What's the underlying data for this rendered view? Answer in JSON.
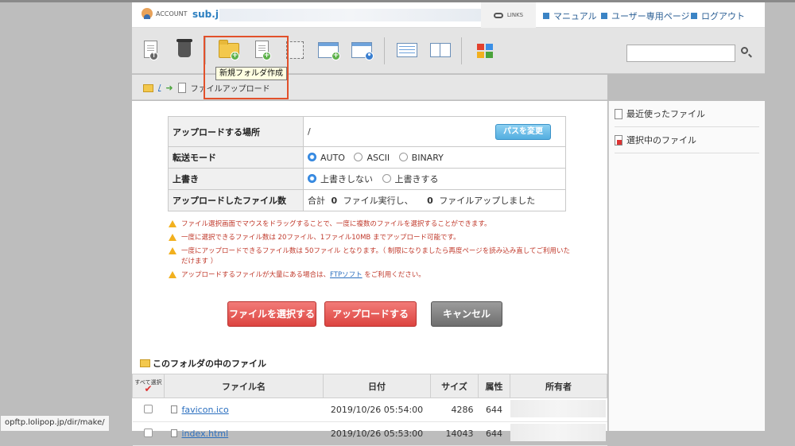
{
  "header": {
    "account_label": "ACCOUNT",
    "domain": "sub.jp-",
    "links_label": "LINKS",
    "nav": [
      "マニュアル",
      "ユーザー専用ページ",
      "ログアウト"
    ]
  },
  "toolbar": {
    "tooltip": "新規フォルダ作成",
    "search_value": ""
  },
  "breadcrumb": {
    "root": "/",
    "current": "ファイルアップロード"
  },
  "right_panel": {
    "recent": "最近使ったファイル",
    "selected": "選択中のファイル"
  },
  "upload_form": {
    "location_label": "アップロードする場所",
    "location_value": "/",
    "change_path_button": "パスを変更",
    "mode_label": "転送モード",
    "mode_options": [
      "AUTO",
      "ASCII",
      "BINARY"
    ],
    "mode_selected": "AUTO",
    "overwrite_label": "上書き",
    "overwrite_options": [
      "上書きしない",
      "上書きする"
    ],
    "overwrite_selected": "上書きしない",
    "count_label": "アップロードしたファイル数",
    "count_total_prefix": "合計",
    "count_total": "0",
    "count_total_suffix": "ファイル実行し、",
    "count_uploaded": "0",
    "count_uploaded_suffix": "ファイルアップしました"
  },
  "notes": [
    "ファイル選択画面でマウスをドラッグすることで、一度に複数のファイルを選択することができます。",
    "一度に選択できるファイル数は 20ファイル、1ファイル10MB までアップロード可能です。",
    "一度にアップロードできるファイル数は 50ファイル となります。（ 制限になりましたら再度ページを読み込み直してご利用いただけます ）"
  ],
  "note_ftp": {
    "before": "アップロードするファイルが大量にある場合は、",
    "link": "FTPソフト",
    "after": " をご利用ください。"
  },
  "buttons": {
    "select_files": "ファイルを選択する",
    "upload": "アップロードする",
    "cancel": "キャンセル"
  },
  "folder_files": {
    "title": "このフォルダの中のファイル",
    "select_all": "すべて選択",
    "columns": [
      "ファイル名",
      "日付",
      "サイズ",
      "属性",
      "所有者"
    ],
    "rows": [
      {
        "name": "favicon.ico",
        "date": "2019/10/26 05:54:00",
        "size": "4286",
        "attr": "644"
      },
      {
        "name": "index.html",
        "date": "2019/10/26 05:53:00",
        "size": "14043",
        "attr": "644"
      }
    ]
  },
  "statusbar": "opftp.lolipop.jp/dir/make/"
}
